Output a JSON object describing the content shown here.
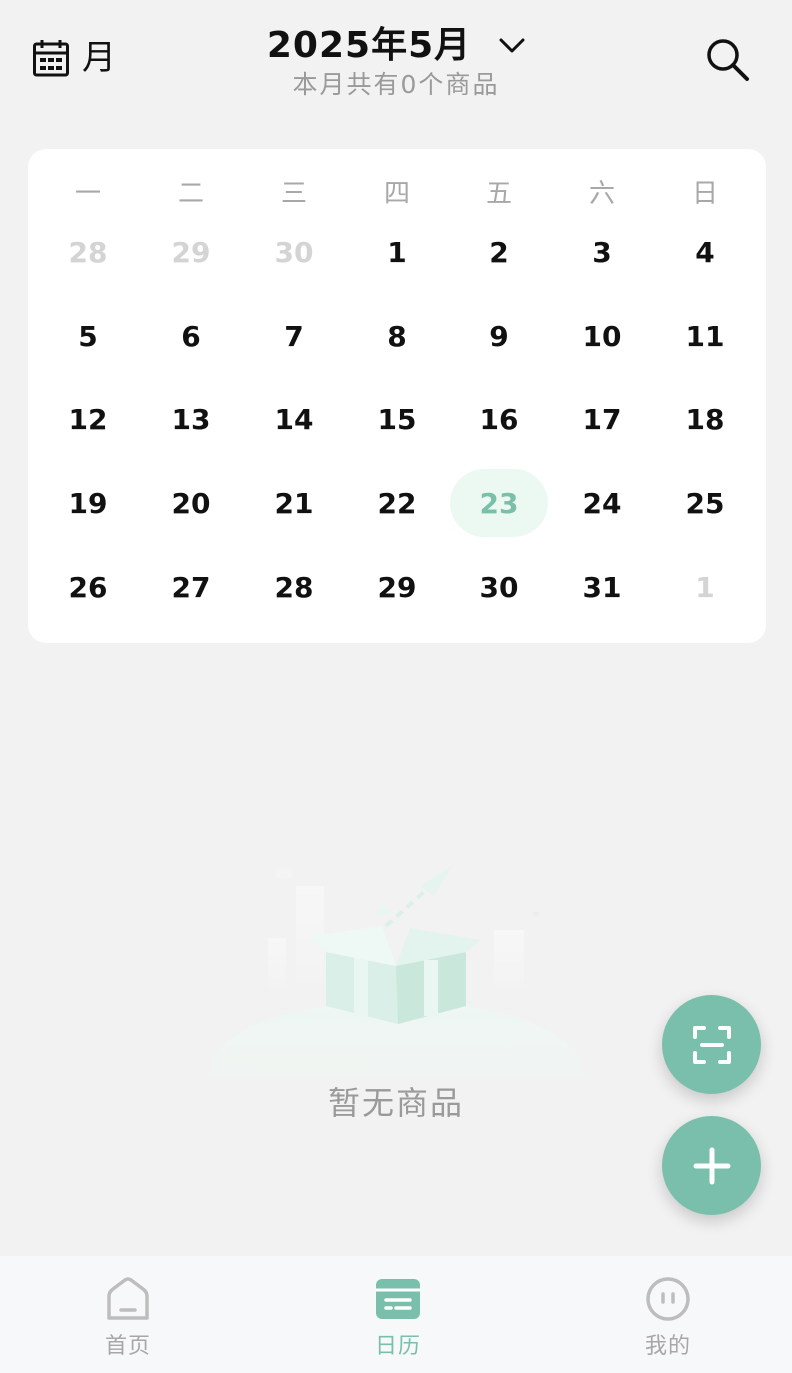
{
  "header": {
    "view_mode_label": "月",
    "month_title": "2025年5月",
    "month_subtitle": "本月共有0个商品"
  },
  "calendar": {
    "weekdays": [
      "一",
      "二",
      "三",
      "四",
      "五",
      "六",
      "日"
    ],
    "weeks": [
      [
        {
          "d": "28",
          "s": "muted"
        },
        {
          "d": "29",
          "s": "muted"
        },
        {
          "d": "30",
          "s": "muted"
        },
        {
          "d": "1"
        },
        {
          "d": "2"
        },
        {
          "d": "3"
        },
        {
          "d": "4"
        }
      ],
      [
        {
          "d": "5"
        },
        {
          "d": "6"
        },
        {
          "d": "7"
        },
        {
          "d": "8"
        },
        {
          "d": "9"
        },
        {
          "d": "10"
        },
        {
          "d": "11"
        }
      ],
      [
        {
          "d": "12"
        },
        {
          "d": "13"
        },
        {
          "d": "14"
        },
        {
          "d": "15"
        },
        {
          "d": "16"
        },
        {
          "d": "17"
        },
        {
          "d": "18"
        }
      ],
      [
        {
          "d": "19"
        },
        {
          "d": "20"
        },
        {
          "d": "21"
        },
        {
          "d": "22"
        },
        {
          "d": "23",
          "s": "today"
        },
        {
          "d": "24"
        },
        {
          "d": "25"
        }
      ],
      [
        {
          "d": "26"
        },
        {
          "d": "27"
        },
        {
          "d": "28"
        },
        {
          "d": "29"
        },
        {
          "d": "30"
        },
        {
          "d": "31"
        },
        {
          "d": "1",
          "s": "muted"
        }
      ]
    ]
  },
  "empty_state": {
    "text": "暂无商品",
    "illustration_icon": "empty-box-icon"
  },
  "fab": {
    "scan_icon": "scan-icon",
    "add_icon": "plus-icon"
  },
  "nav": {
    "items": [
      {
        "label": "首页",
        "icon": "home-icon"
      },
      {
        "label": "日历",
        "icon": "calendar-card-icon"
      },
      {
        "label": "我的",
        "icon": "profile-face-icon"
      }
    ],
    "active_index": 1
  },
  "colors": {
    "accent": "#7abfab",
    "today_bg": "#ecf9f3",
    "page_bg": "#f2f2f2",
    "muted_day": "#d4d4d4"
  }
}
